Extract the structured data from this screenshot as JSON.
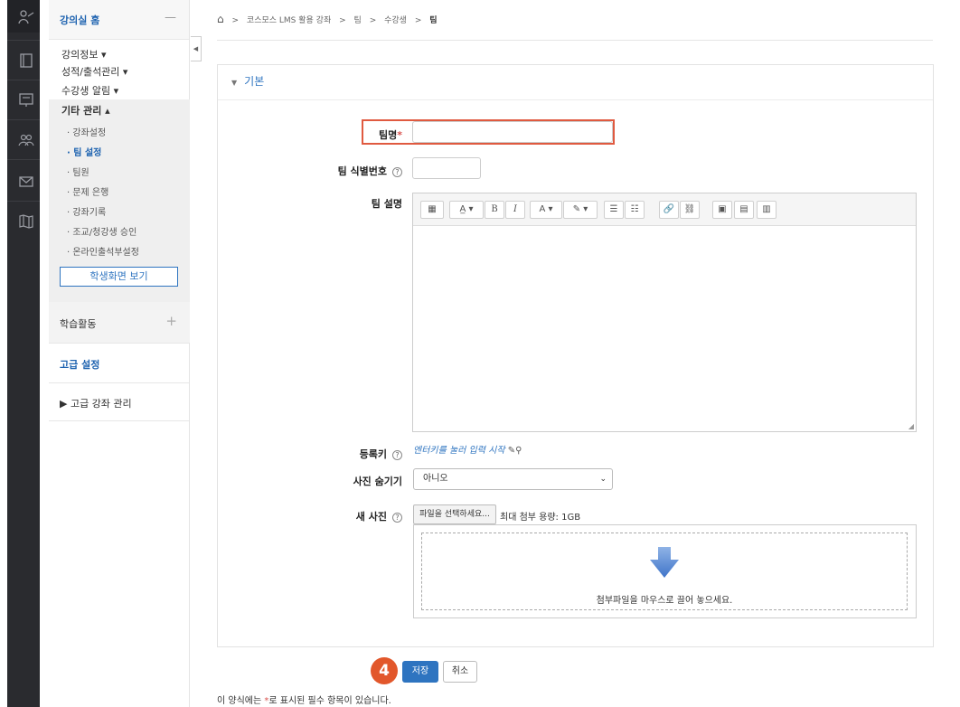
{
  "rail": {
    "icons": [
      "teacher-icon",
      "book-icon",
      "presentation-icon",
      "people-icon",
      "mail-icon",
      "map-icon"
    ]
  },
  "menu": {
    "home": "강의실 홈",
    "collapse": "—",
    "items": [
      "강의정보 ▾",
      "성적/출석관리 ▾",
      "수강생 알림 ▾"
    ],
    "other_mgmt": "기타 관리 ▴",
    "subs": [
      "· 강좌설정",
      "· 팀 설정",
      "· 팀원",
      "· 문제 은행",
      "· 강좌기록",
      "· 조교/청강생 승인",
      "· 온라인출석부설정"
    ],
    "student_view": "학생화면 보기",
    "activities": "학습활동",
    "activities_plus": "+",
    "advanced": "고급 설정",
    "advanced_mgmt": "▶  고급 강좌 관리"
  },
  "breadcrumb": {
    "items": [
      "코스모스 LMS 활용 강좌",
      "팀",
      "수강생"
    ],
    "current": "팀",
    "sep": ">"
  },
  "form": {
    "legend": "기본",
    "team_name_label": "팀명",
    "required_mark": "*",
    "team_id_label": "팀 식별번호",
    "team_desc_label": "팀 설명",
    "enrol_key_label": "등록키",
    "enrol_key_link": "엔터키를 눌러 입력 시작",
    "hide_photo_label": "사진 숨기기",
    "hide_photo_value": "아니오",
    "new_photo_label": "새 사진",
    "file_button": "파일을 선택하세요...",
    "max_size": "최대 첨부 용량: 1GB",
    "drop_text": "첨부파일을 마우스로 끌어 놓으세요.",
    "help": "?"
  },
  "toolbar": [
    "▦",
    "A̲ ▾",
    "B",
    "I",
    "A ▾",
    "✎ ▾",
    "☰",
    "☷",
    "🔗",
    "⛓",
    "▣",
    "▤",
    "▥"
  ],
  "actions": {
    "step_badge": "4",
    "save": "저장",
    "cancel": "취소"
  },
  "footnote": {
    "prefix": "이 양식에는 ",
    "star": "*",
    "suffix": "로 표시된 필수 항목이 있습니다."
  }
}
